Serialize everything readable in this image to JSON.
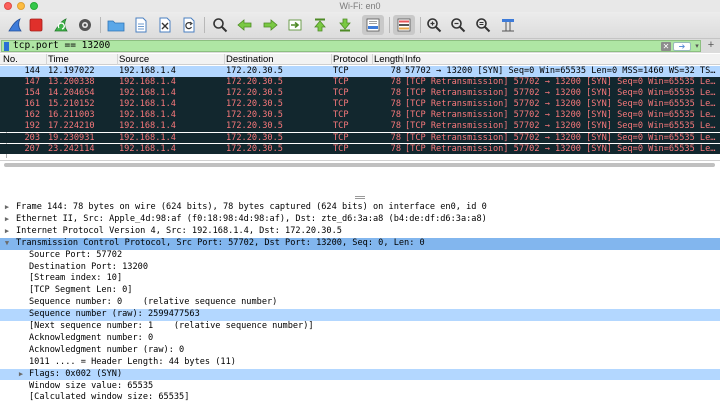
{
  "window": {
    "title": "Wi-Fi: en0"
  },
  "toolbar": {
    "icons": [
      "shark-fin-start-icon",
      "stop-icon",
      "restart-icon",
      "capture-options-icon",
      "open-folder-icon",
      "file-icon",
      "close-file-icon",
      "reload-icon",
      "find-icon",
      "back-arrow-icon",
      "forward-arrow-icon",
      "go-to-packet-icon",
      "first-packet-icon",
      "last-packet-icon",
      "autoscroll-icon",
      "colorize-icon",
      "zoom-in-icon",
      "zoom-out-icon",
      "normal-size-icon",
      "resize-columns-icon"
    ]
  },
  "filter": {
    "value": "tcp.port == 13200",
    "clear_label": "✕",
    "apply_label": "➔",
    "dropdown_label": "▾",
    "add_label": "+"
  },
  "packet_list": {
    "columns": [
      "No.",
      "Time",
      "Source",
      "Destination",
      "Protocol",
      "Length",
      "Info"
    ],
    "rows": [
      {
        "no": "144",
        "time": "12.197022",
        "src": "192.168.1.4",
        "dst": "172.20.30.5",
        "proto": "TCP",
        "len": "78",
        "info": "57702 → 13200 [SYN] Seq=0 Win=65535 Len=0 MSS=1460 WS=32 TS…",
        "state": "selected"
      },
      {
        "no": "147",
        "time": "13.200338",
        "src": "192.168.1.4",
        "dst": "172.20.30.5",
        "proto": "TCP",
        "len": "78",
        "info": "[TCP Retransmission] 57702 → 13200 [SYN] Seq=0 Win=65535 Le…",
        "state": "retransmission"
      },
      {
        "no": "154",
        "time": "14.204654",
        "src": "192.168.1.4",
        "dst": "172.20.30.5",
        "proto": "TCP",
        "len": "78",
        "info": "[TCP Retransmission] 57702 → 13200 [SYN] Seq=0 Win=65535 Le…",
        "state": "retransmission"
      },
      {
        "no": "161",
        "time": "15.210152",
        "src": "192.168.1.4",
        "dst": "172.20.30.5",
        "proto": "TCP",
        "len": "78",
        "info": "[TCP Retransmission] 57702 → 13200 [SYN] Seq=0 Win=65535 Le…",
        "state": "retransmission"
      },
      {
        "no": "162",
        "time": "16.211003",
        "src": "192.168.1.4",
        "dst": "172.20.30.5",
        "proto": "TCP",
        "len": "78",
        "info": "[TCP Retransmission] 57702 → 13200 [SYN] Seq=0 Win=65535 Le…",
        "state": "retransmission"
      },
      {
        "no": "192",
        "time": "17.224210",
        "src": "192.168.1.4",
        "dst": "172.20.30.5",
        "proto": "TCP",
        "len": "78",
        "info": "[TCP Retransmission] 57702 → 13200 [SYN] Seq=0 Win=65535 Le…",
        "state": "retransmission"
      },
      {
        "no": "203",
        "time": "19.230931",
        "src": "192.168.1.4",
        "dst": "172.20.30.5",
        "proto": "TCP",
        "len": "78",
        "info": "[TCP Retransmission] 57702 → 13200 [SYN] Seq=0 Win=65535 Le…",
        "state": "retransmission"
      },
      {
        "no": "207",
        "time": "23.242114",
        "src": "192.168.1.4",
        "dst": "172.20.30.5",
        "proto": "TCP",
        "len": "78",
        "info": "[TCP Retransmission] 57702 → 13200 [SYN] Seq=0 Win=65535 Le…",
        "state": "retransmission"
      }
    ]
  },
  "details": {
    "lines": [
      {
        "text": "Frame 144: 78 bytes on wire (624 bits), 78 bytes captured (624 bits) on interface en0, id 0",
        "level": 0,
        "expander": "collapsed",
        "highlight": "none"
      },
      {
        "text": "Ethernet II, Src: Apple_4d:98:af (f0:18:98:4d:98:af), Dst: zte_d6:3a:a8 (b4:de:df:d6:3a:a8)",
        "level": 0,
        "expander": "collapsed",
        "highlight": "none"
      },
      {
        "text": "Internet Protocol Version 4, Src: 192.168.1.4, Dst: 172.20.30.5",
        "level": 0,
        "expander": "collapsed",
        "highlight": "none"
      },
      {
        "text": "Transmission Control Protocol, Src Port: 57702, Dst Port: 13200, Seq: 0, Len: 0",
        "level": 0,
        "expander": "expanded",
        "highlight": "blue"
      },
      {
        "text": "Source Port: 57702",
        "level": 1,
        "expander": "none",
        "highlight": "none"
      },
      {
        "text": "Destination Port: 13200",
        "level": 1,
        "expander": "none",
        "highlight": "none"
      },
      {
        "text": "[Stream index: 10]",
        "level": 1,
        "expander": "none",
        "highlight": "none"
      },
      {
        "text": "[TCP Segment Len: 0]",
        "level": 1,
        "expander": "none",
        "highlight": "none"
      },
      {
        "text": "Sequence number: 0    (relative sequence number)",
        "level": 1,
        "expander": "none",
        "highlight": "none"
      },
      {
        "text": "Sequence number (raw): 2599477563",
        "level": 1,
        "expander": "none",
        "highlight": "light"
      },
      {
        "text": "[Next sequence number: 1    (relative sequence number)]",
        "level": 1,
        "expander": "none",
        "highlight": "none"
      },
      {
        "text": "Acknowledgment number: 0",
        "level": 1,
        "expander": "none",
        "highlight": "none"
      },
      {
        "text": "Acknowledgment number (raw): 0",
        "level": 1,
        "expander": "none",
        "highlight": "none"
      },
      {
        "text": "1011 .... = Header Length: 44 bytes (11)",
        "level": 1,
        "expander": "none",
        "highlight": "none"
      },
      {
        "text": "Flags: 0x002 (SYN)",
        "level": 1,
        "expander": "collapsed",
        "highlight": "light"
      },
      {
        "text": "Window size value: 65535",
        "level": 1,
        "expander": "none",
        "highlight": "none"
      },
      {
        "text": "[Calculated window size: 65535]",
        "level": 1,
        "expander": "none",
        "highlight": "none"
      }
    ]
  }
}
